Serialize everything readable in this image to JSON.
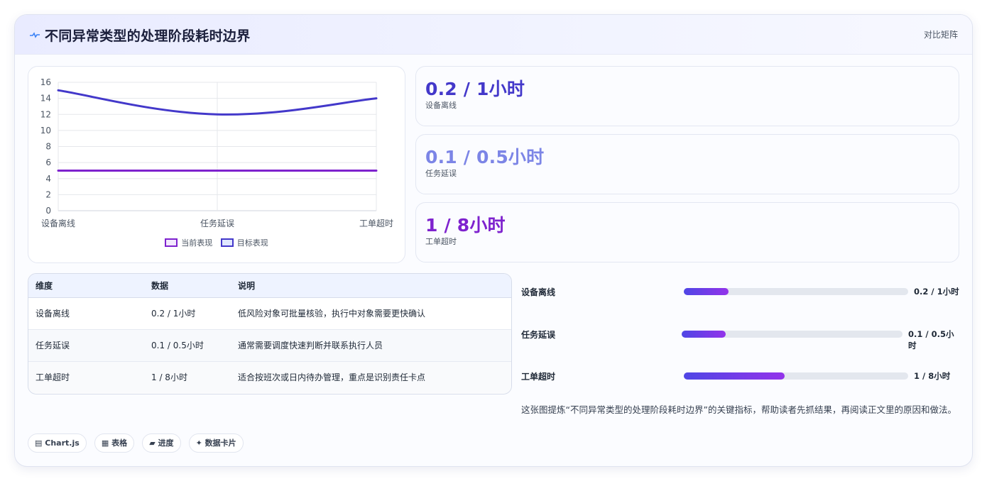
{
  "header": {
    "title": "不同异常类型的处理阶段耗时边界",
    "compare_label": "对比矩阵",
    "icon": "pulse-icon"
  },
  "chart_data": {
    "type": "line",
    "categories": [
      "设备离线",
      "任务延误",
      "工单超时"
    ],
    "series": [
      {
        "name": "当前表现",
        "values": [
          5,
          5,
          5
        ],
        "color": "#7e22ce"
      },
      {
        "name": "目标表现",
        "values": [
          15,
          12,
          14
        ],
        "color": "#4338ca"
      }
    ],
    "ylim": [
      0,
      16
    ],
    "yticks": [
      0,
      2,
      4,
      6,
      8,
      10,
      12,
      14,
      16
    ],
    "grid": true,
    "legend": "bottom",
    "curve": "smooth"
  },
  "stats": [
    {
      "value": "0.2 / 1小时",
      "label": "设备离线",
      "color": "#4338ca"
    },
    {
      "value": "0.1 / 0.5小时",
      "label": "任务延误",
      "color": "#7c85e6"
    },
    {
      "value": "1 / 8小时",
      "label": "工单超时",
      "color": "#7e22ce"
    }
  ],
  "table": {
    "headers": [
      "维度",
      "数据",
      "说明"
    ],
    "rows": [
      [
        "设备离线",
        "0.2 / 1小时",
        "低风险对象可批量核验，执行中对象需要更快确认"
      ],
      [
        "任务延误",
        "0.1 / 0.5小时",
        "通常需要调度快速判断并联系执行人员"
      ],
      [
        "工单超时",
        "1 / 8小时",
        "适合按班次或日内待办管理，重点是识别责任卡点"
      ]
    ]
  },
  "progress": [
    {
      "label": "设备离线",
      "value_text": "0.2 / 1小时",
      "fraction": 0.2
    },
    {
      "label": "任务延误",
      "value_text": "0.1 / 0.5小时",
      "fraction": 0.2
    },
    {
      "label": "工单超时",
      "value_text": "1 / 8小时",
      "fraction": 0.45
    }
  ],
  "note": "这张图提炼“不同异常类型的处理阶段耗时边界”的关键指标，帮助读者先抓结果，再阅读正文里的原因和做法。",
  "tags": [
    {
      "icon": "chart-icon",
      "glyph": "▤",
      "label": "Chart.js"
    },
    {
      "icon": "table-icon",
      "glyph": "▦",
      "label": "表格"
    },
    {
      "icon": "progress-icon",
      "glyph": "▰",
      "label": "进度"
    },
    {
      "icon": "sparkle-icon",
      "glyph": "✦",
      "label": "数据卡片"
    }
  ]
}
